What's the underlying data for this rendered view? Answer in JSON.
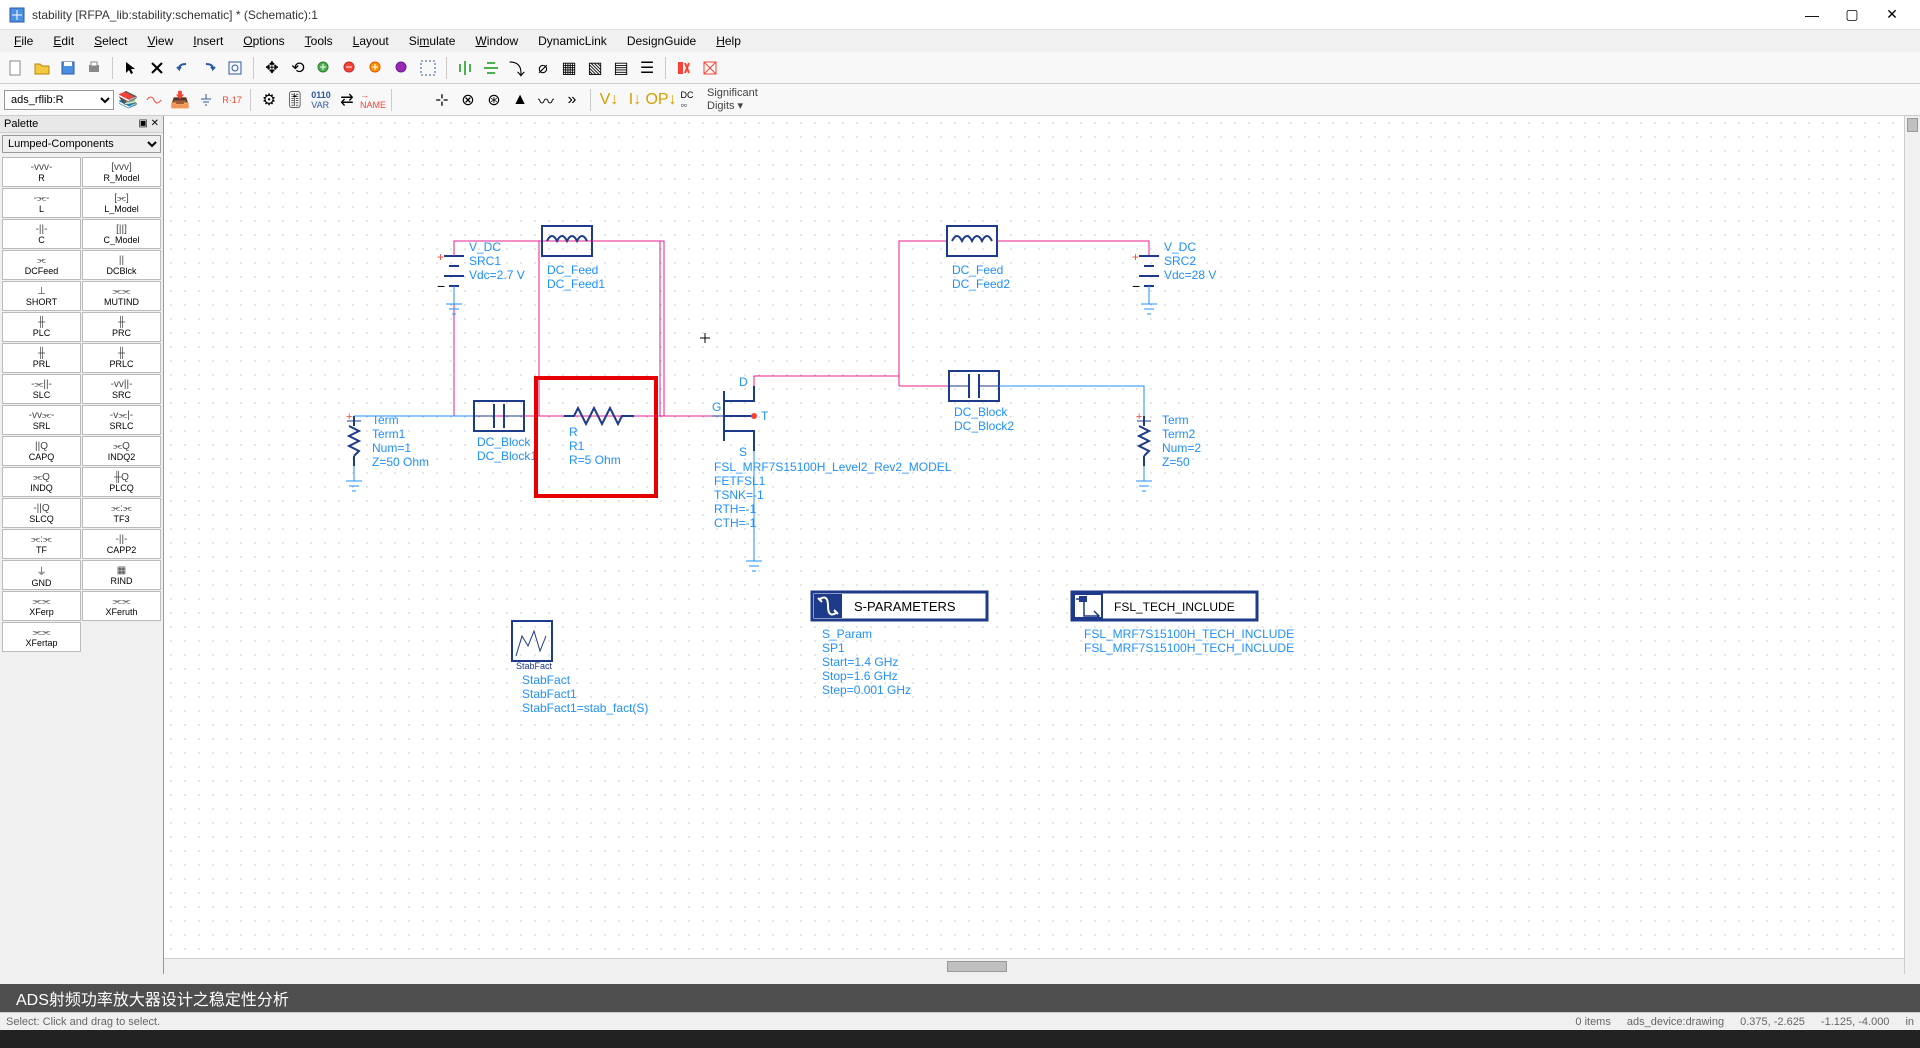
{
  "window": {
    "title": "stability [RFPA_lib:stability:schematic] * (Schematic):1"
  },
  "menu": [
    "File",
    "Edit",
    "Select",
    "View",
    "Insert",
    "Options",
    "Tools",
    "Layout",
    "Simulate",
    "Window",
    "DynamicLink",
    "DesignGuide",
    "Help"
  ],
  "toolbar2": {
    "combo": "ads_rflib:R",
    "siglabel": "Significant\nDigits"
  },
  "palette": {
    "title": "Palette",
    "category": "Lumped-Components",
    "items": [
      [
        "R",
        "R_Model"
      ],
      [
        "L",
        "L_Model"
      ],
      [
        "C",
        "C_Model"
      ],
      [
        "DCFeed",
        "DCBlck"
      ],
      [
        "SHORT",
        "MUTIND"
      ],
      [
        "PLC",
        "PRC"
      ],
      [
        "PRL",
        "PRLC"
      ],
      [
        "SLC",
        "SRC"
      ],
      [
        "SRL",
        "SRLC"
      ],
      [
        "CAPQ",
        "INDQ2"
      ],
      [
        "INDQ",
        "PLCQ"
      ],
      [
        "SLCQ",
        "TF3"
      ],
      [
        "TF",
        "CAPP2"
      ],
      [
        "GND",
        "RIND"
      ],
      [
        "XFerp",
        "XFeruth"
      ],
      [
        "XFertap",
        ""
      ]
    ]
  },
  "schematic": {
    "vdc1": {
      "name": "V_DC",
      "inst": "SRC1",
      "val": "Vdc=2.7 V"
    },
    "vdc2": {
      "name": "V_DC",
      "inst": "SRC2",
      "val": "Vdc=28 V"
    },
    "dcfeed1": {
      "name": "DC_Feed",
      "inst": "DC_Feed1"
    },
    "dcfeed2": {
      "name": "DC_Feed",
      "inst": "DC_Feed2"
    },
    "dcblock1": {
      "name": "DC_Block",
      "inst": "DC_Block1"
    },
    "dcblock2": {
      "name": "DC_Block",
      "inst": "DC_Block2"
    },
    "r1": {
      "name": "R",
      "inst": "R1",
      "val": "R=5 Ohm"
    },
    "term1": {
      "name": "Term",
      "inst": "Term1",
      "p1": "Num=1",
      "p2": "Z=50 Ohm"
    },
    "term2": {
      "name": "Term",
      "inst": "Term2",
      "p1": "Num=2",
      "p2": "Z=50"
    },
    "fet": {
      "model": "FSL_MRF7S15100H_Level2_Rev2_MODEL",
      "inst": "FETFSL1",
      "p1": "TSNK=-1",
      "p2": "RTH=-1",
      "p3": "CTH=-1"
    },
    "stabfact": {
      "name": "StabFact",
      "inst": "StabFact1",
      "expr": "StabFact1=stab_fact(S)"
    },
    "sparam": {
      "title": "S-PARAMETERS",
      "name": "S_Param",
      "inst": "SP1",
      "p1": "Start=1.4 GHz",
      "p2": "Stop=1.6 GHz",
      "p3": "Step=0.001 GHz"
    },
    "tech": {
      "title": "FSL_TECH_INCLUDE",
      "line1": "FSL_MRF7S15100H_TECH_INCLUDE",
      "line2": "FSL_MRF7S15100H_TECH_INCLUDE"
    },
    "pins": {
      "g": "G",
      "d": "D",
      "s": "S",
      "t": "T"
    }
  },
  "status": {
    "left": "Select: Click and drag to select.",
    "items": "0 items",
    "layer": "ads_device:drawing",
    "coord1": "0.375, -2.625",
    "coord2": "-1.125, -4.000",
    "unit": "in"
  },
  "caption": "ADS射频功率放大器设计之稳定性分析"
}
